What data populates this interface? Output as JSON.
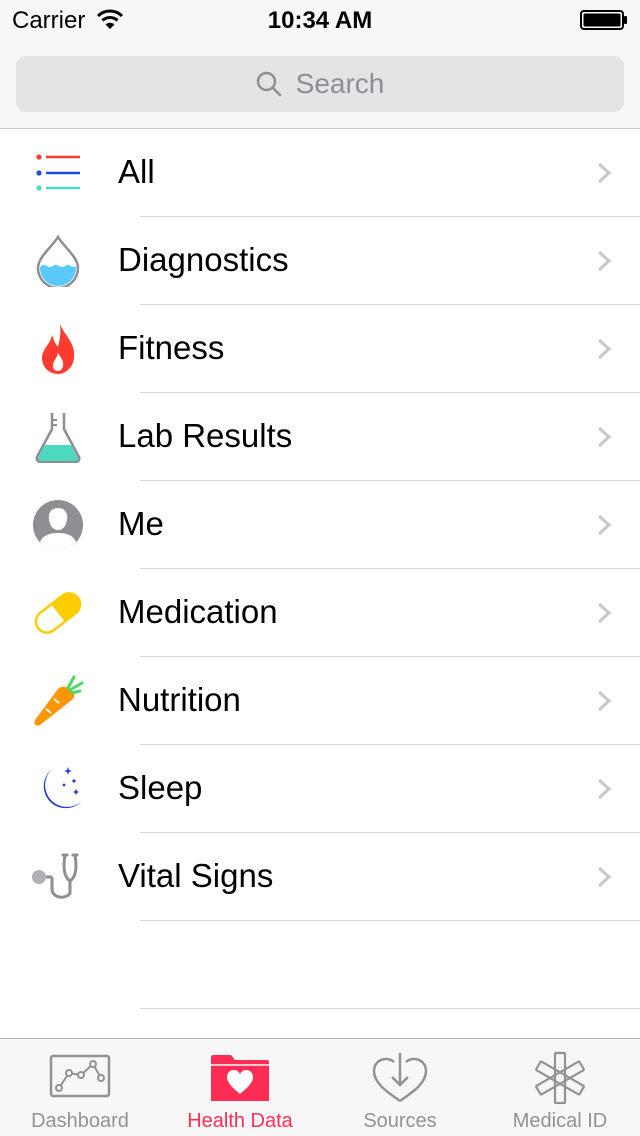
{
  "status_bar": {
    "carrier": "Carrier",
    "time": "10:34 AM"
  },
  "search": {
    "placeholder": "Search"
  },
  "categories": [
    {
      "label": "All",
      "icon": "list-icon"
    },
    {
      "label": "Diagnostics",
      "icon": "water-drop-icon"
    },
    {
      "label": "Fitness",
      "icon": "flame-icon"
    },
    {
      "label": "Lab Results",
      "icon": "flask-icon"
    },
    {
      "label": "Me",
      "icon": "person-icon"
    },
    {
      "label": "Medication",
      "icon": "pill-icon"
    },
    {
      "label": "Nutrition",
      "icon": "carrot-icon"
    },
    {
      "label": "Sleep",
      "icon": "moon-icon"
    },
    {
      "label": "Vital Signs",
      "icon": "stethoscope-icon"
    }
  ],
  "tab_bar": {
    "active_tab": "Health Data",
    "active_color": "#ff2d55",
    "tabs": [
      {
        "label": "Dashboard",
        "icon": "chart-icon"
      },
      {
        "label": "Health Data",
        "icon": "folder-heart-icon"
      },
      {
        "label": "Sources",
        "icon": "heart-download-icon"
      },
      {
        "label": "Medical ID",
        "icon": "star-of-life-icon"
      }
    ]
  }
}
